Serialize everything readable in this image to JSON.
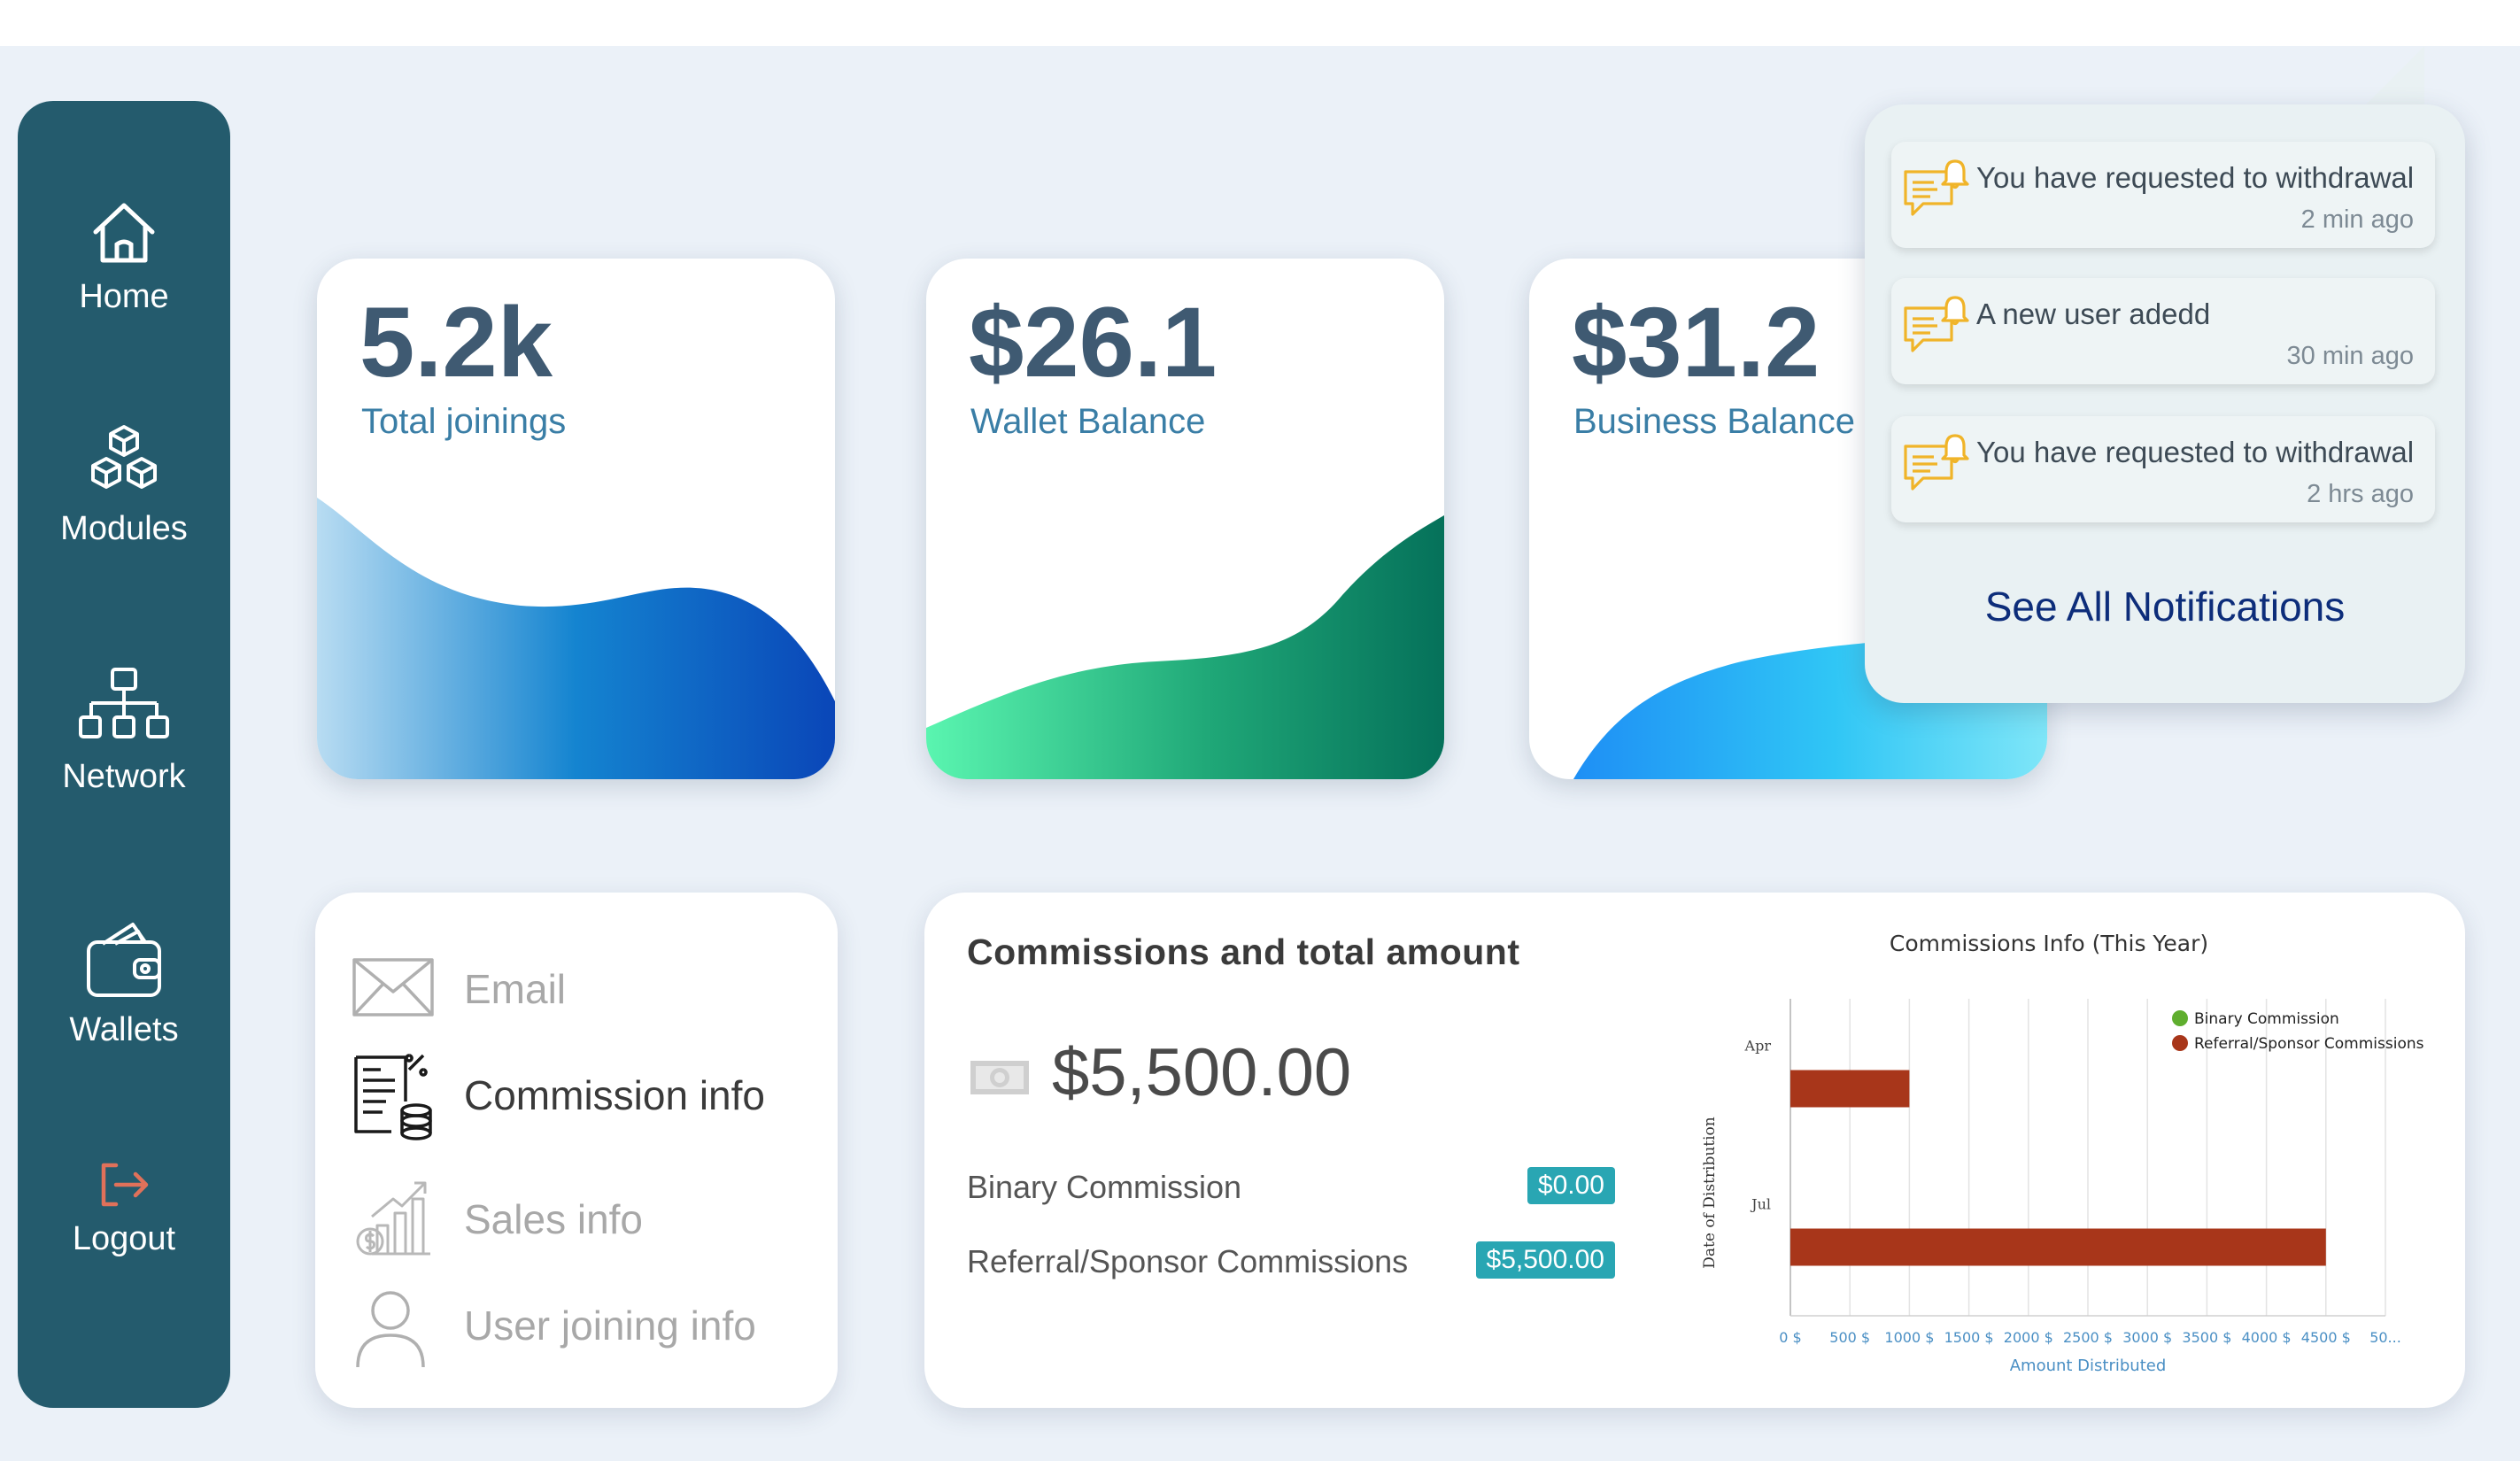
{
  "sidebar": {
    "items": [
      {
        "label": "Home",
        "icon": "home-icon"
      },
      {
        "label": "Modules",
        "icon": "cubes-icon"
      },
      {
        "label": "Network",
        "icon": "network-icon"
      },
      {
        "label": "Wallets",
        "icon": "wallet-icon"
      },
      {
        "label": "Logout",
        "icon": "logout-icon"
      }
    ],
    "color": "#245b6d",
    "logout_icon_color": "#e0715a"
  },
  "stats": [
    {
      "value": "5.2k",
      "label": "Total joinings",
      "gradient": [
        "#b8dcf2",
        "#1484d0",
        "#0a46b8"
      ]
    },
    {
      "value": "$26.1",
      "label": "Wallet Balance",
      "gradient": [
        "#5af5b0",
        "#1fa777",
        "#05715a"
      ]
    },
    {
      "value": "$31.2",
      "label": "Business Balance",
      "gradient": [
        "#1e8ff5",
        "#30c6f5",
        "#7fe6f8"
      ]
    }
  ],
  "notifications": {
    "items": [
      {
        "text": "You have requested to withdrawal",
        "time": "2 min ago"
      },
      {
        "text": "A new user adedd",
        "time": "30 min ago"
      },
      {
        "text": "You have requested to withdrawal",
        "time": "2 hrs ago"
      }
    ],
    "see_all": "See All Notifications",
    "icon_color": "#f0b429"
  },
  "info_menu": {
    "items": [
      {
        "label": "Email",
        "icon": "envelope-icon",
        "active": false
      },
      {
        "label": "Commission info",
        "icon": "commission-document-icon",
        "active": true
      },
      {
        "label": "Sales info",
        "icon": "sales-chart-icon",
        "active": false
      },
      {
        "label": "User joining info",
        "icon": "user-icon",
        "active": false
      }
    ]
  },
  "commissions": {
    "title": "Commissions and total amount",
    "total": "$5,500.00",
    "rows": [
      {
        "label": "Binary Commission",
        "amount": "$0.00"
      },
      {
        "label": "Referral/Sponsor Commissions",
        "amount": "$5,500.00"
      }
    ],
    "badge_color": "#29a6b3"
  },
  "chart_data": {
    "type": "bar",
    "orientation": "horizontal",
    "title": "Commissions Info (This Year)",
    "xlabel": "Amount Distributed",
    "ylabel": "Date of Distribution",
    "categories": [
      "Apr",
      "Jul"
    ],
    "x_ticks": [
      "0 $",
      "500 $",
      "1000 $",
      "1500 $",
      "2000 $",
      "2500 $",
      "3000 $",
      "3500 $",
      "4000 $",
      "4500 $",
      "50..."
    ],
    "xlim": [
      0,
      5000
    ],
    "series": [
      {
        "name": "Binary Commission",
        "color": "#5fae2e",
        "values": [
          0,
          0
        ]
      },
      {
        "name": "Referral/Sponsor Commissions",
        "color": "#a8361a",
        "values": [
          1000,
          4500
        ]
      }
    ],
    "legend": "top-right",
    "grid": true
  }
}
